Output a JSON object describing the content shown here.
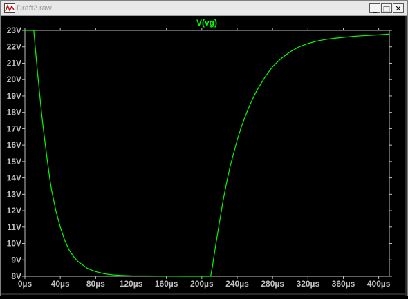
{
  "window": {
    "title": "Draft2.raw",
    "buttons": {
      "minimize": "_",
      "maximize": "□",
      "close": "✕"
    }
  },
  "colors": {
    "background": "#000000",
    "trace": "#00ff00",
    "axis_text": "#c0c0c0",
    "frame": "#c0c0c0"
  },
  "chart_data": {
    "type": "line",
    "title": "",
    "trace_label": "V(vg)",
    "xlabel": "",
    "ylabel": "",
    "grid": false,
    "xlim": [
      0,
      412
    ],
    "ylim": [
      8,
      23
    ],
    "x_ticks": [
      "0µs",
      "40µs",
      "80µs",
      "120µs",
      "160µs",
      "200µs",
      "240µs",
      "280µs",
      "320µs",
      "360µs",
      "400µs"
    ],
    "x_tick_values": [
      0,
      40,
      80,
      120,
      160,
      200,
      240,
      280,
      320,
      360,
      400
    ],
    "y_ticks": [
      "8V",
      "9V",
      "10V",
      "11V",
      "12V",
      "13V",
      "14V",
      "15V",
      "16V",
      "17V",
      "18V",
      "19V",
      "20V",
      "21V",
      "22V",
      "23V"
    ],
    "y_tick_values": [
      8,
      9,
      10,
      11,
      12,
      13,
      14,
      15,
      16,
      17,
      18,
      19,
      20,
      21,
      22,
      23
    ],
    "series": [
      {
        "name": "V(vg)",
        "x": [
          0,
          10,
          12,
          14,
          16,
          18,
          20,
          22,
          25,
          28,
          30,
          35,
          40,
          45,
          50,
          55,
          60,
          65,
          70,
          75,
          80,
          90,
          100,
          110,
          120,
          140,
          160,
          180,
          200,
          210,
          212,
          216,
          220,
          224,
          228,
          232,
          236,
          240,
          244,
          248,
          252,
          256,
          260,
          264,
          268,
          272,
          276,
          280,
          285,
          290,
          295,
          300,
          310,
          320,
          330,
          340,
          350,
          360,
          370,
          380,
          390,
          400,
          412
        ],
        "y": [
          23,
          23,
          21.8,
          20.6,
          19.5,
          18.4,
          17.4,
          16.5,
          15.2,
          14.0,
          13.3,
          12.0,
          11.0,
          10.2,
          9.6,
          9.2,
          8.9,
          8.7,
          8.5,
          8.38,
          8.28,
          8.15,
          8.08,
          8.05,
          8.03,
          8.02,
          8.01,
          8.0,
          8.0,
          8.0,
          8.6,
          10.0,
          11.3,
          12.6,
          13.7,
          14.7,
          15.5,
          16.3,
          17.0,
          17.6,
          18.15,
          18.65,
          19.1,
          19.5,
          19.85,
          20.2,
          20.5,
          20.78,
          21.05,
          21.3,
          21.5,
          21.7,
          22.0,
          22.2,
          22.35,
          22.45,
          22.52,
          22.58,
          22.63,
          22.67,
          22.7,
          22.73,
          22.78
        ]
      }
    ]
  }
}
